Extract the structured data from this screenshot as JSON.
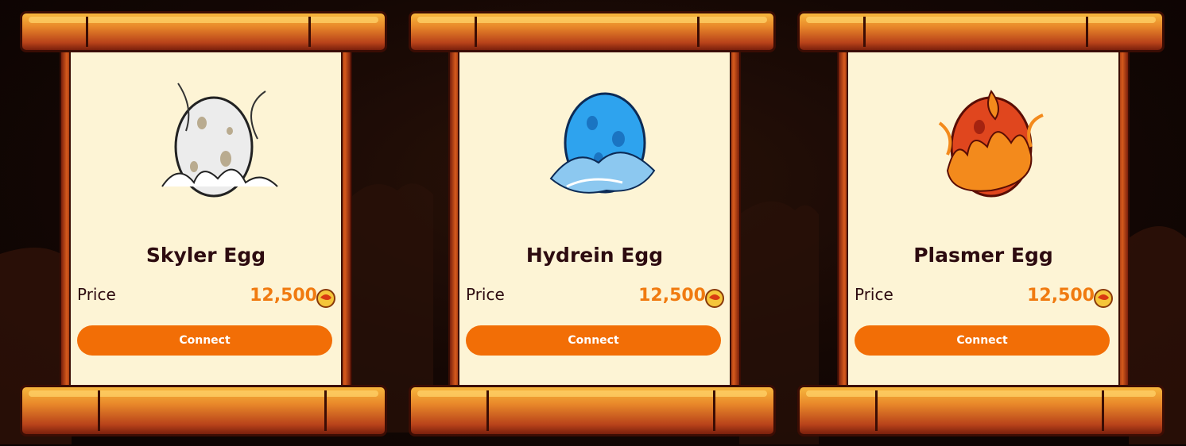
{
  "cards": [
    {
      "title": "Skyler Egg",
      "price_label": "Price",
      "price_value": "12,500",
      "button_label": "Connect",
      "egg_icon": "cloud-egg-icon"
    },
    {
      "title": "Hydrein Egg",
      "price_label": "Price",
      "price_value": "12,500",
      "button_label": "Connect",
      "egg_icon": "water-egg-icon"
    },
    {
      "title": "Plasmer Egg",
      "price_label": "Price",
      "price_value": "12,500",
      "button_label": "Connect",
      "egg_icon": "fire-egg-icon"
    }
  ],
  "colors": {
    "accent": "#f26e06",
    "price": "#f07a10",
    "paper": "#fdf4d5",
    "title_text": "#2d0b10",
    "wood": "#e9892a"
  },
  "currency_icon": "dragon-coin-icon"
}
